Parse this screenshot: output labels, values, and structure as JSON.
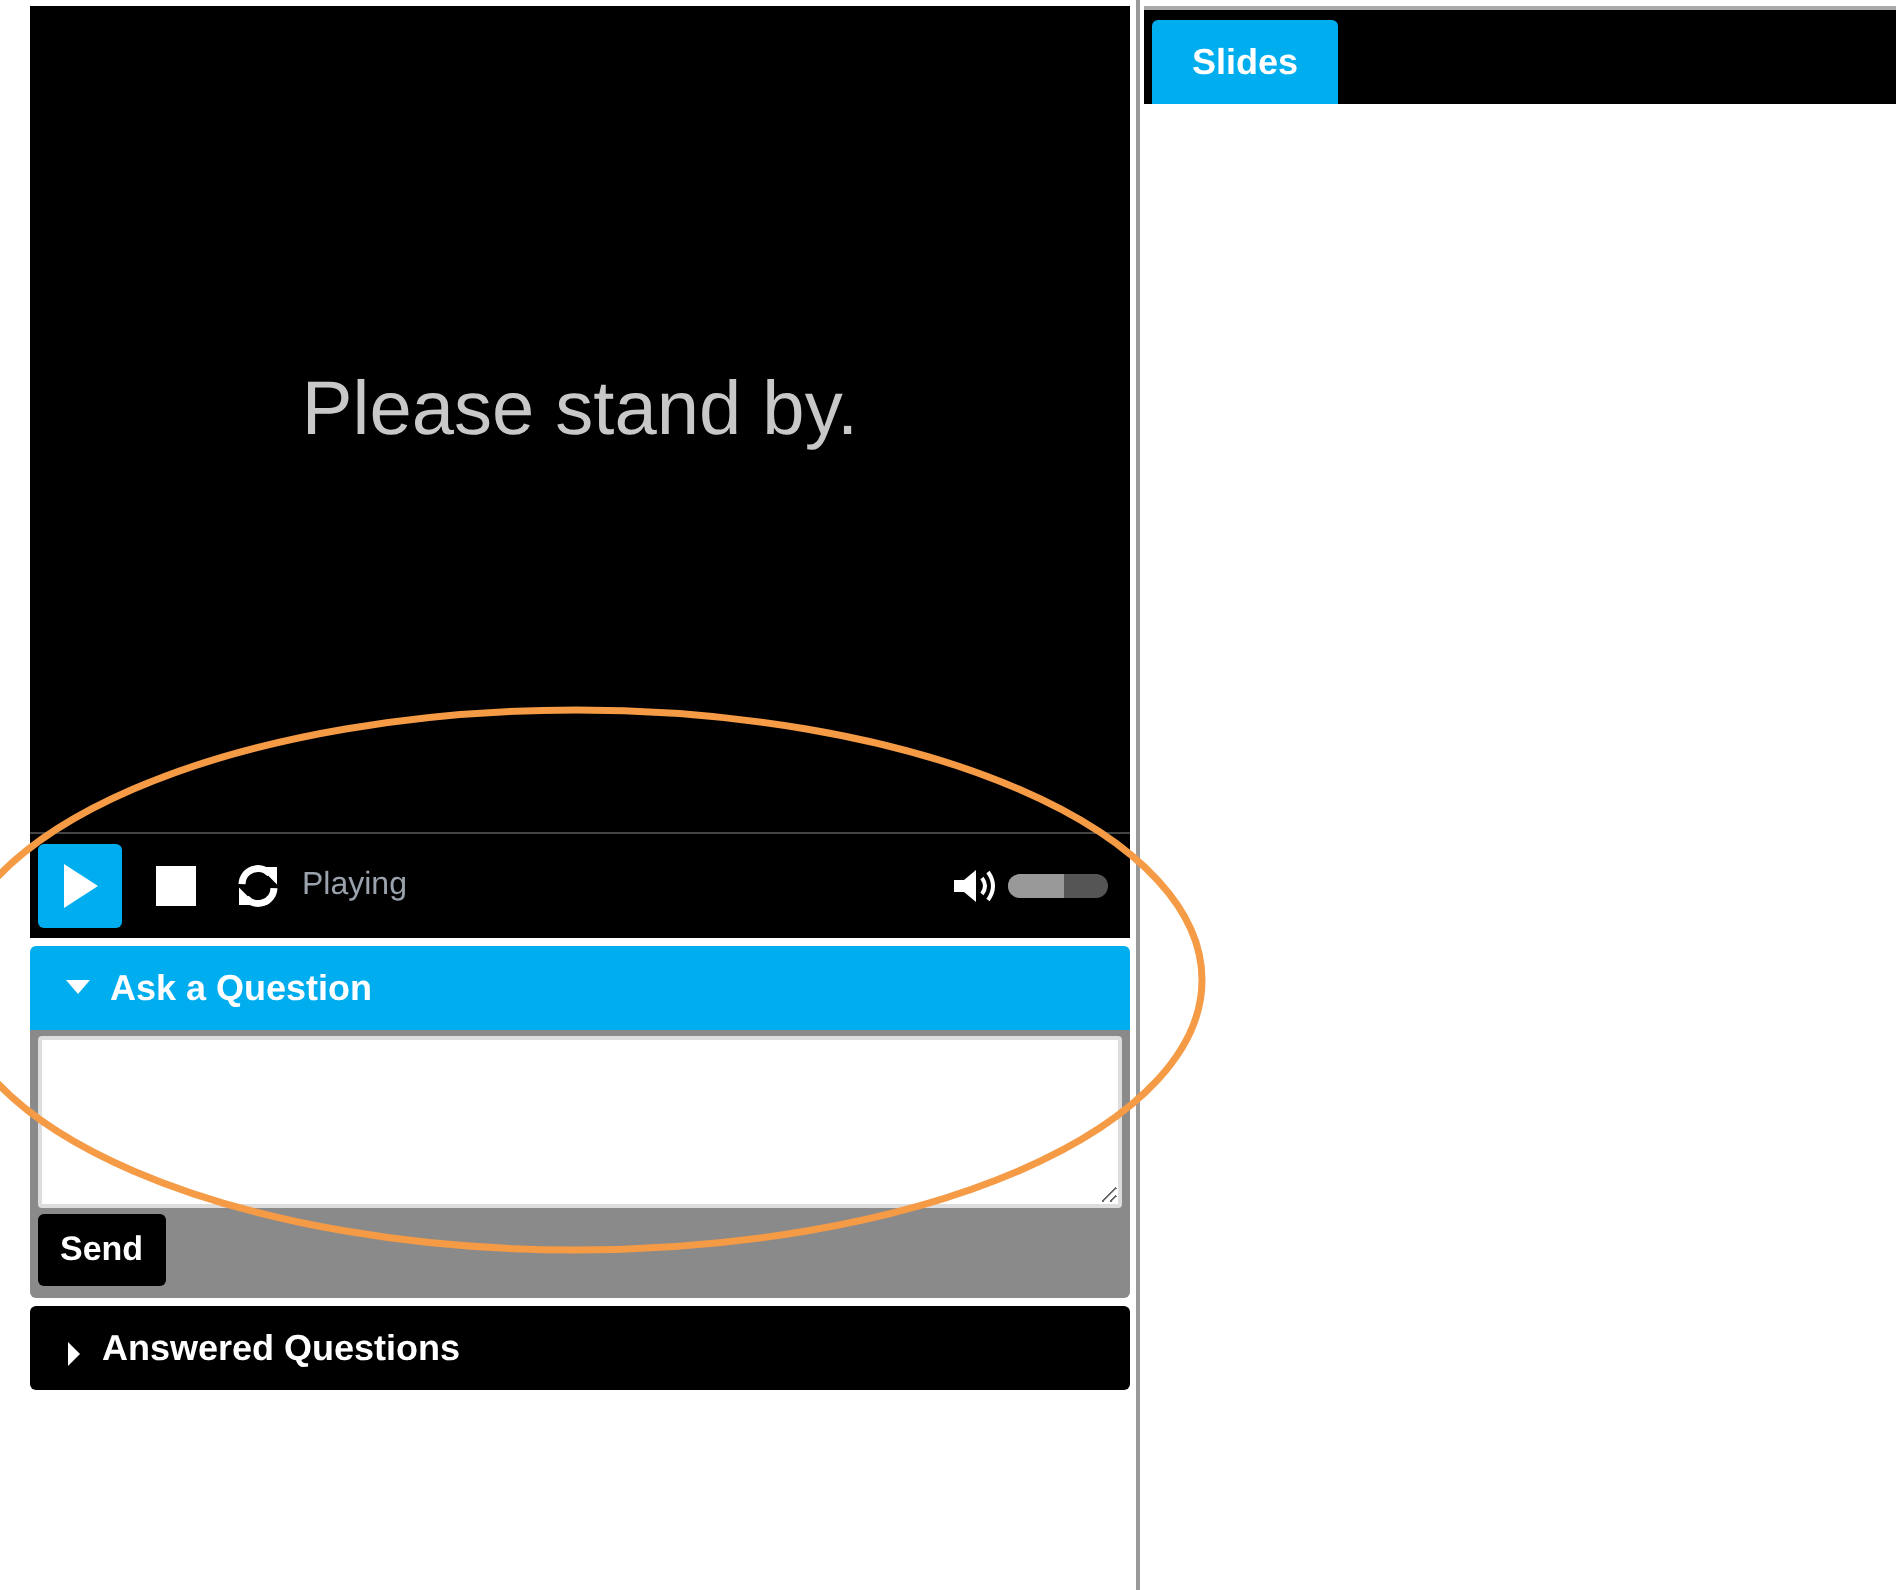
{
  "player": {
    "message": "Please stand by.",
    "playing": true,
    "status": "Playing",
    "volume": {
      "level": 0.55
    }
  },
  "sections": [
    {
      "title": "Ask a Question",
      "expanded": true,
      "send_button": "Send"
    },
    {
      "title": "Answered Questions",
      "expanded": false
    }
  ],
  "tabs": [
    {
      "label": "Slides",
      "selected": true
    }
  ]
}
